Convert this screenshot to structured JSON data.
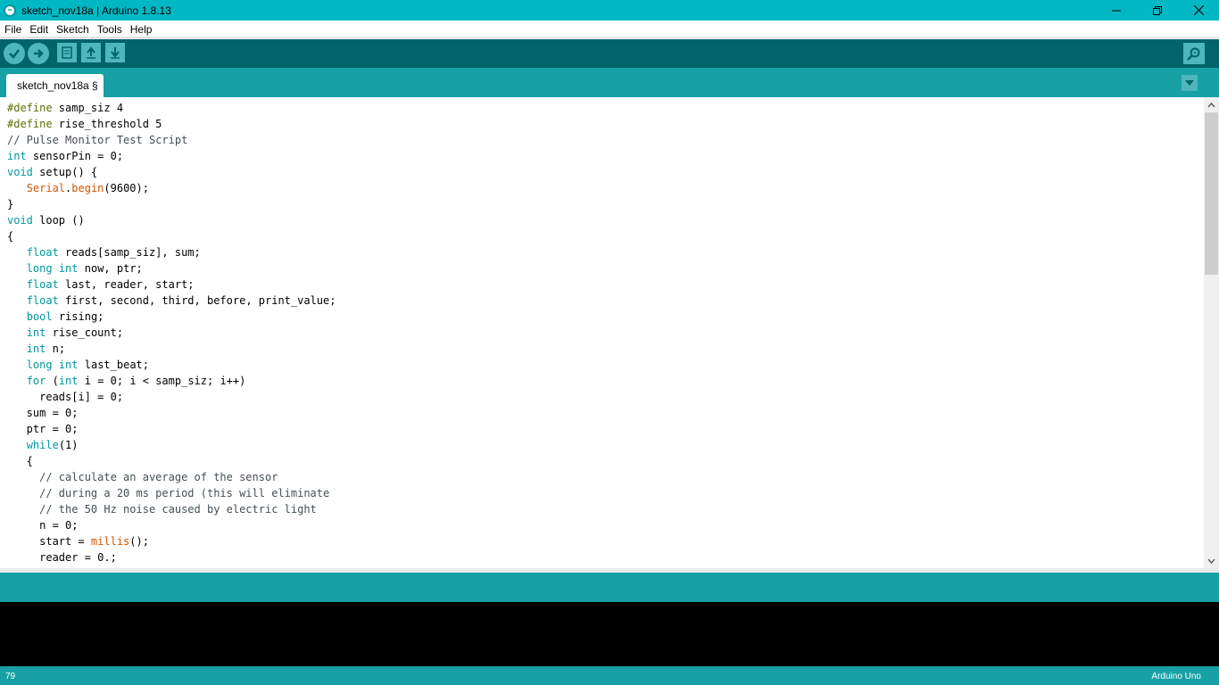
{
  "window": {
    "title": "sketch_nov18a | Arduino 1.8.13",
    "app_icon": "arduino-logo-icon"
  },
  "menu": [
    "File",
    "Edit",
    "Sketch",
    "Tools",
    "Help"
  ],
  "toolbar": {
    "buttons": [
      "verify-icon",
      "upload-icon",
      "new-icon",
      "open-icon",
      "save-icon"
    ],
    "serial_monitor": "serial-monitor-icon"
  },
  "tabs": [
    {
      "label": "sketch_nov18a §",
      "active": true
    }
  ],
  "editor": {
    "lines": [
      "#define samp_siz 4",
      "#define rise_threshold 5",
      "// Pulse Monitor Test Script",
      "int sensorPin = 0;",
      "void setup() {",
      "   Serial.begin(9600);",
      "}",
      "void loop ()",
      "{",
      "   float reads[samp_siz], sum;",
      "   long int now, ptr;",
      "   float last, reader, start;",
      "   float first, second, third, before, print_value;",
      "   bool rising;",
      "   int rise_count;",
      "   int n;",
      "   long int last_beat;",
      "   for (int i = 0; i < samp_siz; i++)",
      "     reads[i] = 0;",
      "   sum = 0;",
      "   ptr = 0;",
      "   while(1)",
      "   {",
      "     // calculate an average of the sensor",
      "     // during a 20 ms period (this will eliminate",
      "     // the 50 Hz noise caused by electric light",
      "     n = 0;",
      "     start = millis();",
      "     reader = 0.;"
    ]
  },
  "status": {
    "line_number": "79",
    "board": "Arduino Uno"
  },
  "colors": {
    "titlebar": "#00b8c4",
    "toolbar": "#006468",
    "tabbar": "#17a1a5",
    "keyword": "#00979c",
    "function": "#d35400",
    "preprocessor": "#5e6d03",
    "comment": "#434f54"
  }
}
